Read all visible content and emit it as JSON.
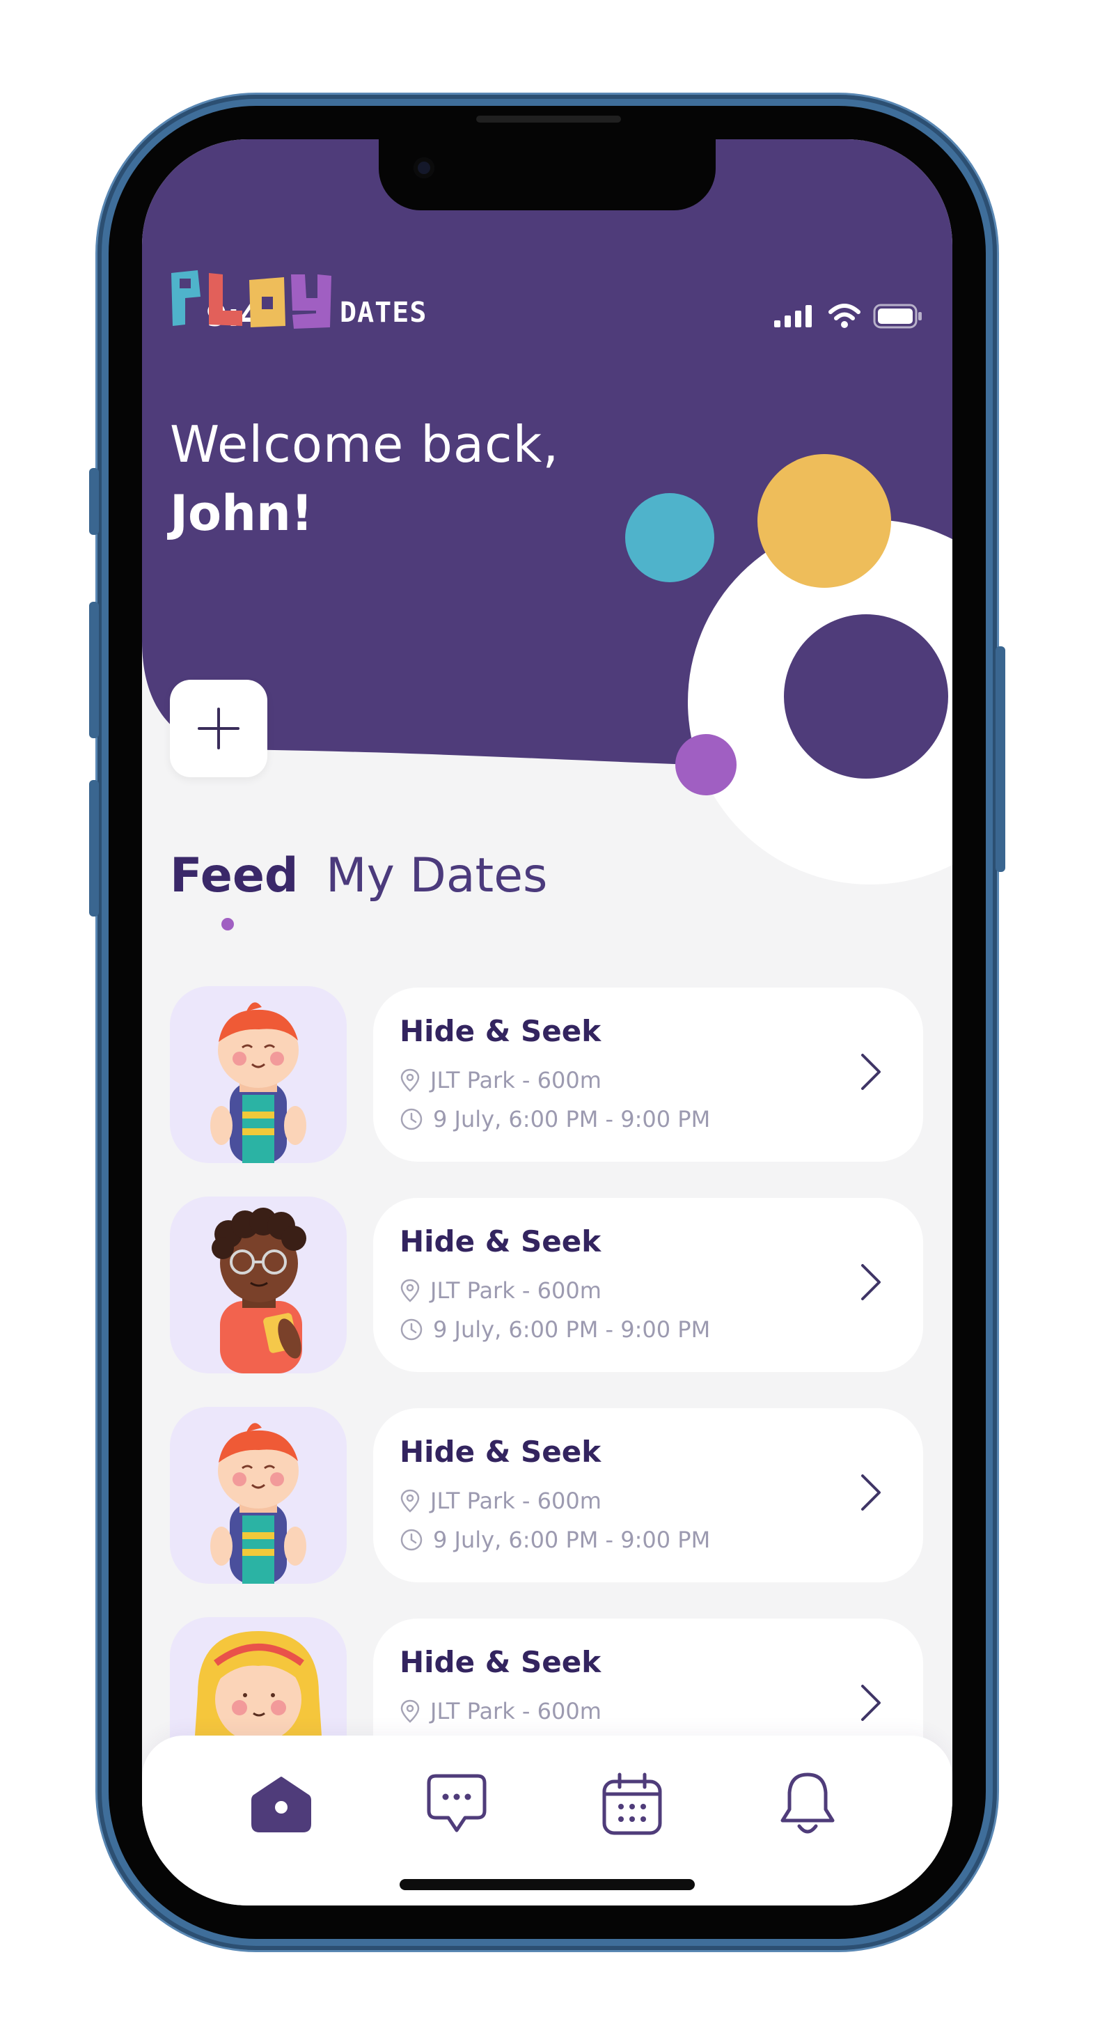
{
  "status_bar": {
    "time": "9:41"
  },
  "brand": {
    "logo_text": "PLAY DATES",
    "logo_word_1": "PLAY",
    "logo_word_2": "DATES"
  },
  "greeting": {
    "line1": "Welcome back,",
    "name": "John!"
  },
  "header": {
    "add_button_icon": "plus-icon"
  },
  "tabs": [
    {
      "label": "Feed",
      "active": true
    },
    {
      "label": "My Dates",
      "active": false
    }
  ],
  "feed": [
    {
      "title": "Hide & Seek",
      "location": "JLT Park - 600m",
      "time": "9 July, 6:00 PM - 9:00 PM",
      "avatar": "boy-red-hair-avatar"
    },
    {
      "title": "Hide & Seek",
      "location": "JLT Park - 600m",
      "time": "9 July, 6:00 PM - 9:00 PM",
      "avatar": "boy-curly-glasses-avatar"
    },
    {
      "title": "Hide & Seek",
      "location": "JLT Park - 600m",
      "time": "9 July, 6:00 PM - 9:00 PM",
      "avatar": "boy-red-hair-avatar"
    },
    {
      "title": "Hide & Seek",
      "location": "JLT Park - 600m",
      "avatar": "girl-blonde-avatar"
    }
  ],
  "nav": [
    {
      "name": "home",
      "icon": "home-icon",
      "active": true
    },
    {
      "name": "messages",
      "icon": "chat-bubble-icon",
      "active": false
    },
    {
      "name": "calendar",
      "icon": "calendar-icon",
      "active": false
    },
    {
      "name": "notifications",
      "icon": "bell-icon",
      "active": false
    }
  ],
  "colors": {
    "header_purple": "#4f3c7a",
    "teal": "#4fb3cb",
    "yellow": "#eebd5a",
    "violet": "#a05fc2",
    "logo_red": "#e2605a",
    "title_text": "#33245f",
    "meta_text": "#9c9ab0"
  }
}
